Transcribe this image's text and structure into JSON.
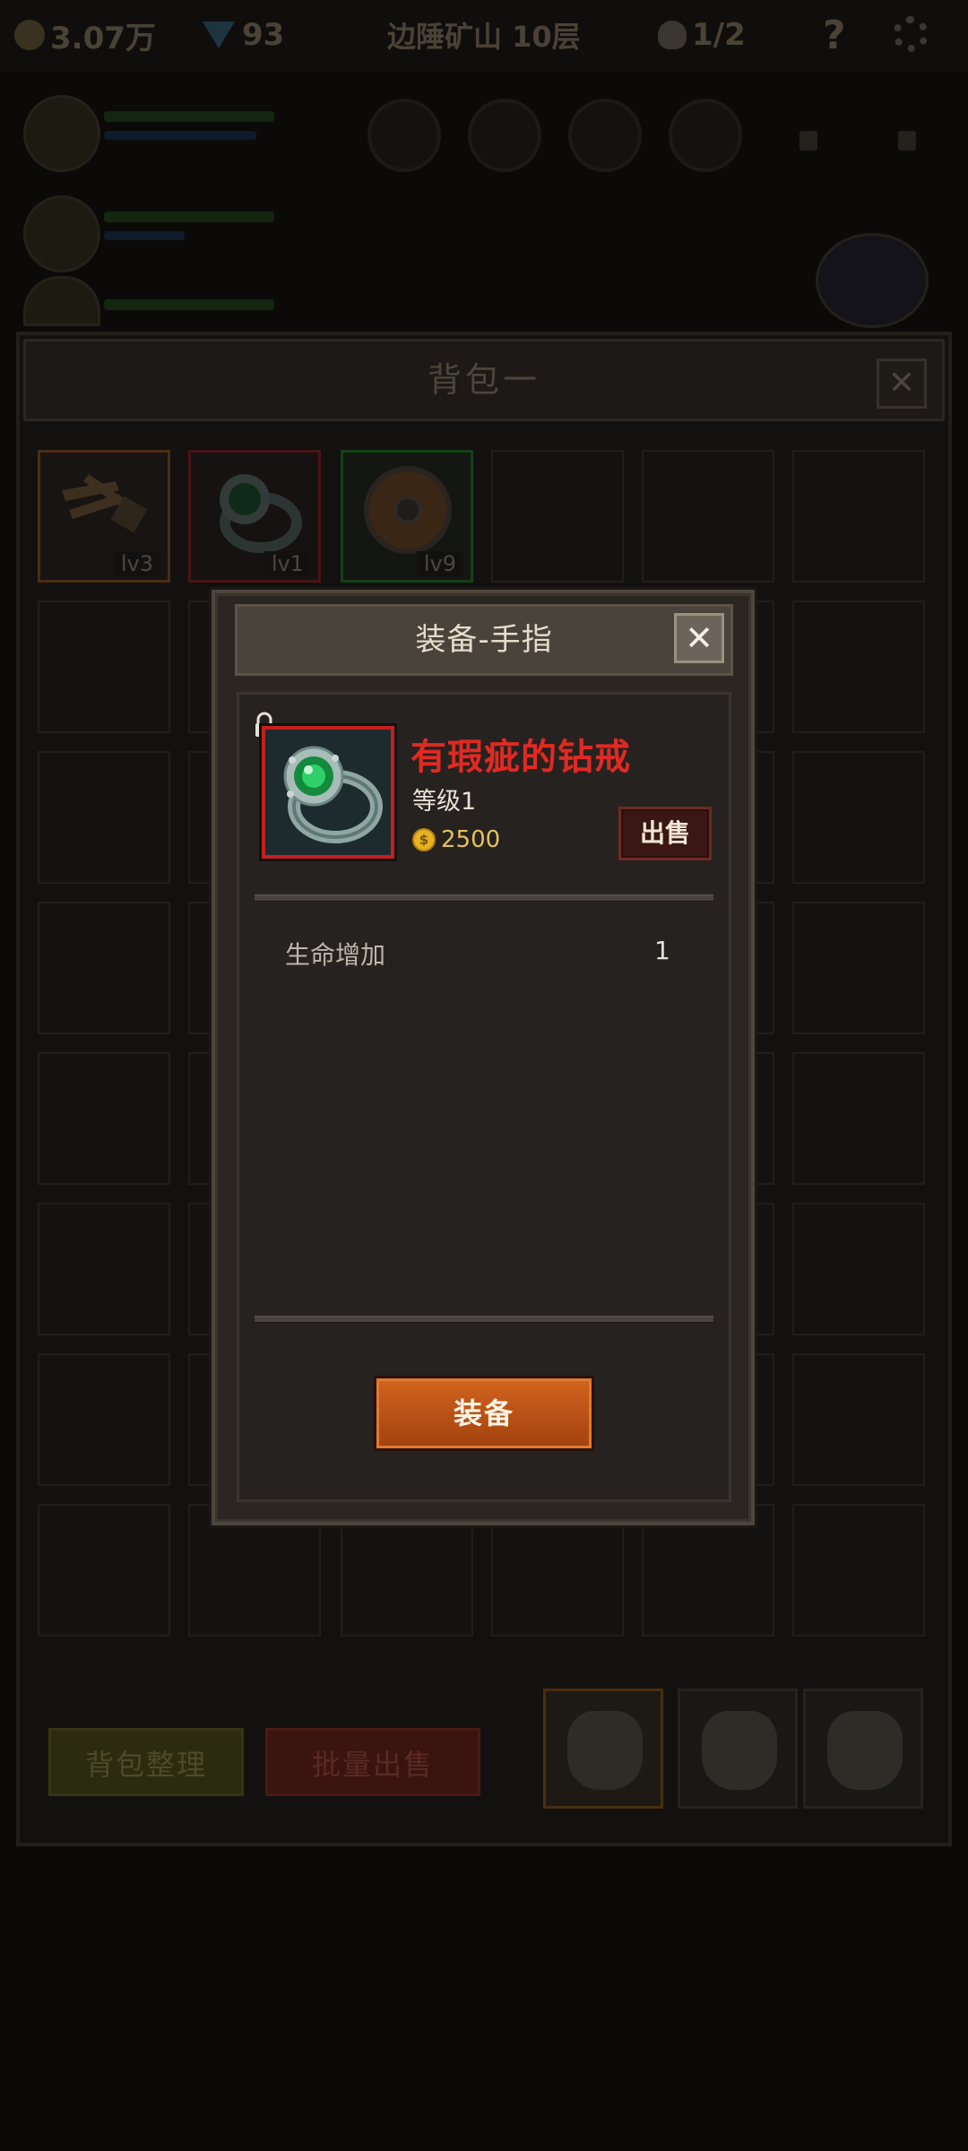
{
  "hud": {
    "gold": "3.07万",
    "gems": "93",
    "location": "边陲矿山 10层",
    "kills": "1/2",
    "help": "?"
  },
  "backpack": {
    "title": "背包一",
    "close": "✕",
    "items": [
      {
        "level": "lv3",
        "rarity": "orange"
      },
      {
        "level": "lv1",
        "rarity": "red"
      },
      {
        "level": "lv9",
        "rarity": "green"
      }
    ],
    "sort_label": "背包整理",
    "batch_sell_label": "批量出售"
  },
  "dialog": {
    "title": "装备-手指",
    "close": "✕",
    "item": {
      "name": "有瑕疵的钻戒",
      "level": "等级1",
      "price": "2500",
      "coin_symbol": "$"
    },
    "sell_label": "出售",
    "stats": [
      {
        "name": "生命增加",
        "value": "1"
      }
    ],
    "equip_label": "装备"
  }
}
